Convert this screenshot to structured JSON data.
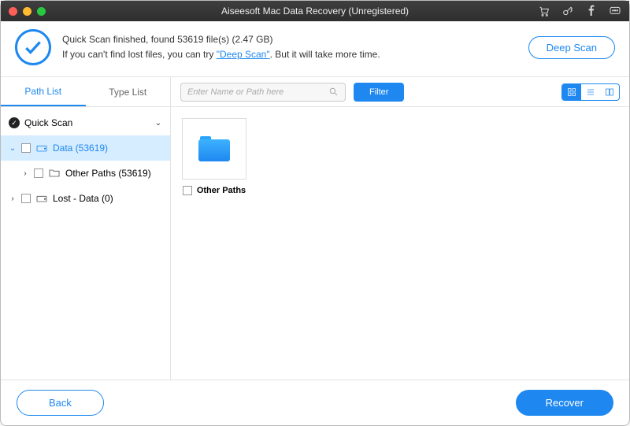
{
  "title": "Aiseesoft Mac Data Recovery (Unregistered)",
  "header": {
    "scan_finished": "Quick Scan finished, found 53619 file(s) (2.47 GB)",
    "if_cant_find_prefix": "If you can't find lost files, you can try ",
    "deep_scan_link": "\"Deep Scan\"",
    "if_cant_find_suffix": ". But it will take more time.",
    "deep_scan_button": "Deep Scan"
  },
  "sidebar": {
    "tabs": {
      "path_list": "Path List",
      "type_list": "Type List"
    },
    "quick_scan_label": "Quick Scan",
    "data_label": "Data (53619)",
    "other_paths_label": "Other Paths (53619)",
    "lost_data_label": "Lost - Data (0)"
  },
  "toolbar": {
    "search_placeholder": "Enter Name or Path here",
    "filter_label": "Filter"
  },
  "content": {
    "tile_label": "Other Paths"
  },
  "footer": {
    "back": "Back",
    "recover": "Recover"
  }
}
